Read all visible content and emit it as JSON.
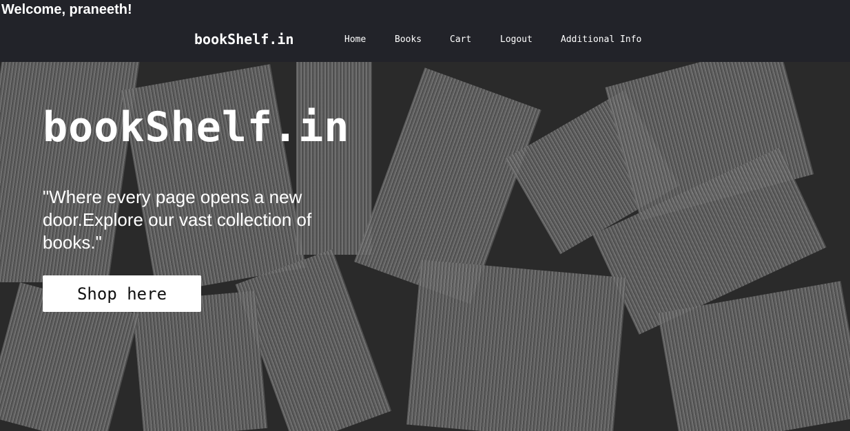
{
  "header": {
    "welcome": "Welcome, praneeth!",
    "brand": "bookShelf.in",
    "nav": [
      {
        "label": "Home"
      },
      {
        "label": "Books"
      },
      {
        "label": "Cart"
      },
      {
        "label": "Logout"
      },
      {
        "label": "Additional Info"
      }
    ]
  },
  "hero": {
    "title": "bookShelf.in",
    "quote": "\"Where every page opens a new door.Explore our vast collection of books.\"",
    "button": "Shop here"
  }
}
